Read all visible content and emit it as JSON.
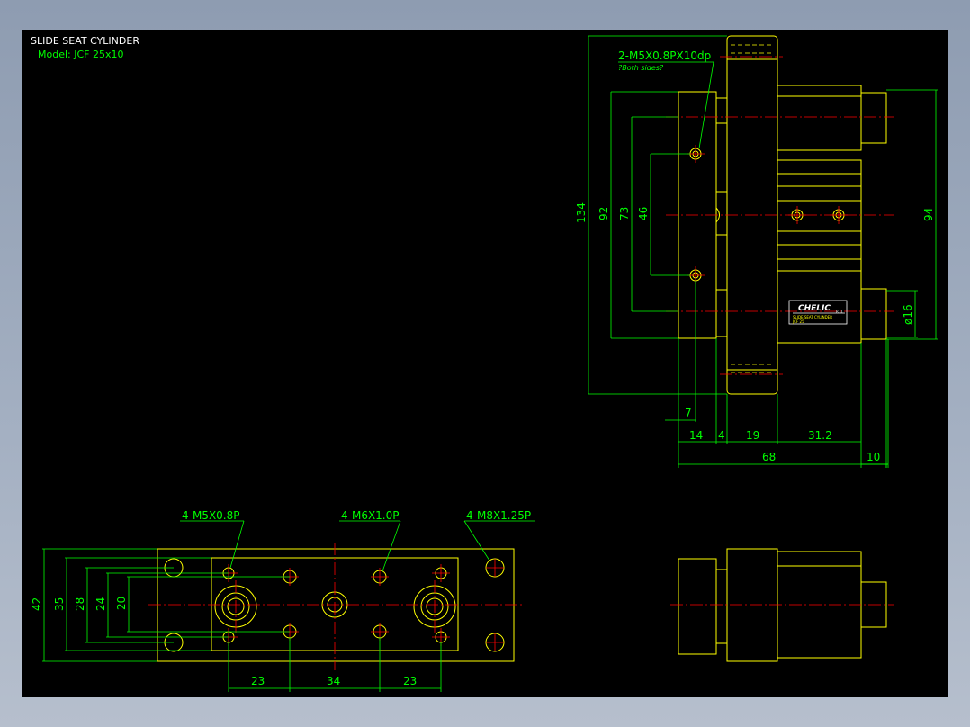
{
  "title": "SLIDE SEAT CYLINDER",
  "model": "Model:  JCF 25x10",
  "side_view": {
    "callout_thread": "2-M5X0.8PX10dp",
    "callout_note": "?Both sides?",
    "dims": {
      "d134": "134",
      "d92": "92",
      "d73": "73",
      "d46": "46",
      "d94": "94",
      "d16": "ø16",
      "d7": "7",
      "d14": "14",
      "d4": "4",
      "d19": "19",
      "d31_2": "31.2",
      "d68": "68",
      "d10": "10"
    },
    "brand": "CHELIC",
    "brand_sub": "R.O.",
    "label_line1": "SLIDE SEAT CYLINDER",
    "label_line2": "JCF 25"
  },
  "bottom_view": {
    "callout_m5": "4-M5X0.8P",
    "callout_m6": "4-M6X1.0P",
    "callout_m8": "4-M8X1.25P",
    "dims": {
      "d42": "42",
      "d35": "35",
      "d28": "28",
      "d24": "24",
      "d20": "20",
      "d23a": "23",
      "d34": "34",
      "d23b": "23"
    }
  },
  "colors": {
    "background": "#000000",
    "outline": "#ffff00",
    "dimension": "#00ff00",
    "centerline": "#ff0000",
    "text": "#ffffff"
  }
}
